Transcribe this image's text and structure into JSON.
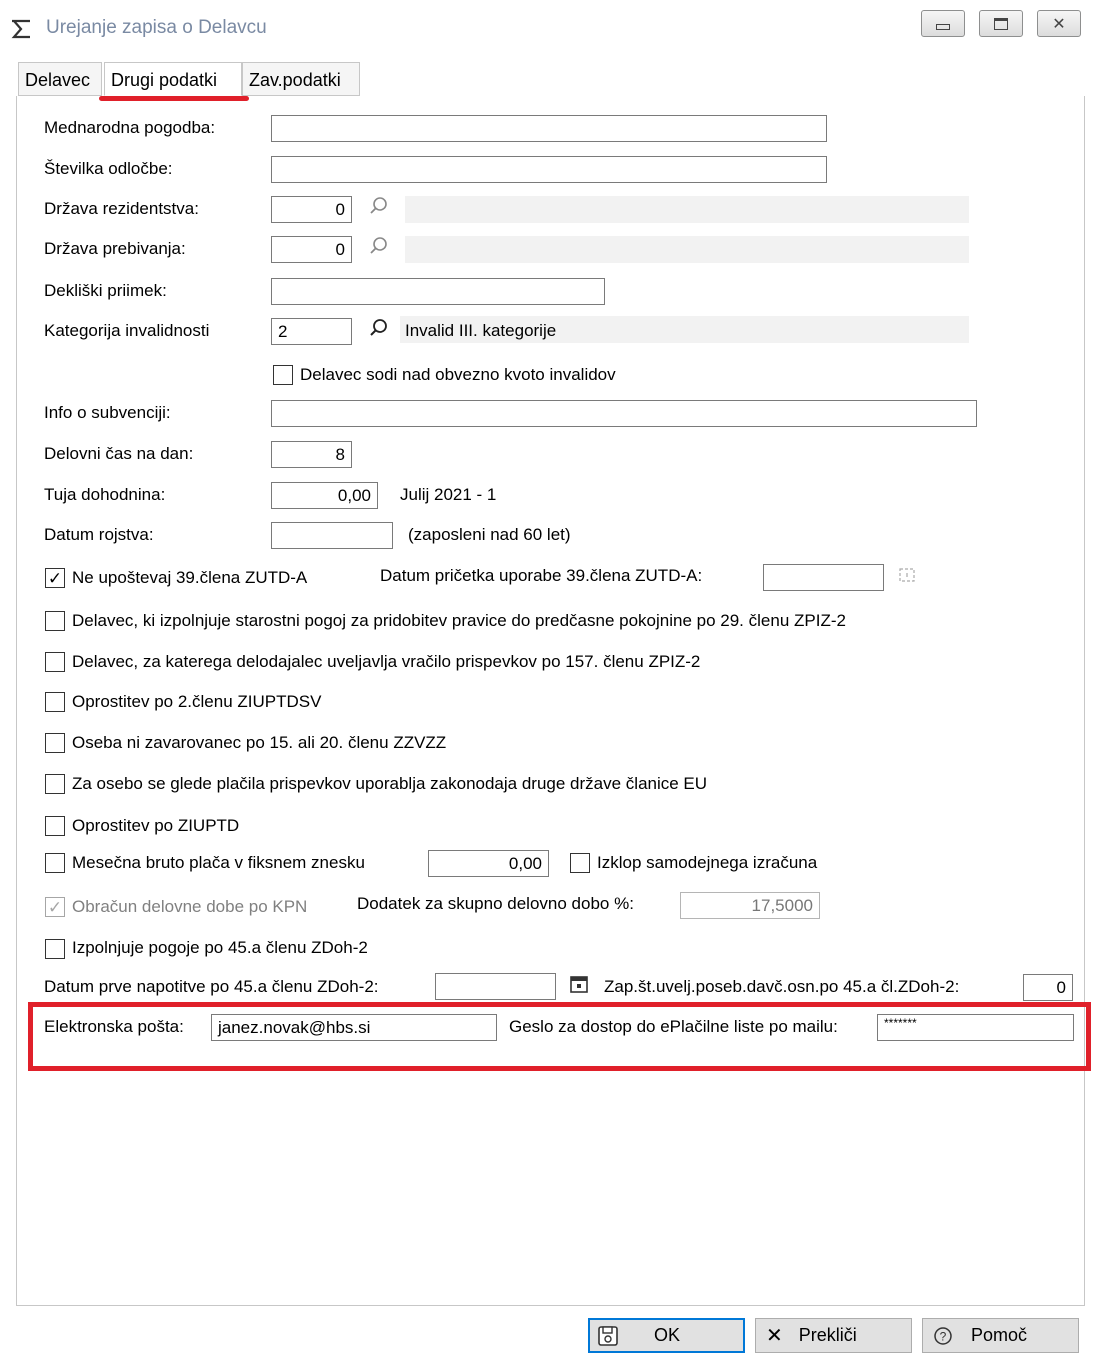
{
  "window": {
    "title": "Urejanje zapisa o Delavcu"
  },
  "tabs": [
    {
      "label": "Delavec"
    },
    {
      "label": "Drugi podatki"
    },
    {
      "label": "Zav.podatki"
    }
  ],
  "form": {
    "mednarodna_pogodba": {
      "label": "Mednarodna pogodba:",
      "value": ""
    },
    "stevilka_odlocbe": {
      "label": "Številka odločbe:",
      "value": ""
    },
    "drzava_rezidentstva": {
      "label": "Država rezidentstva:",
      "value": "0",
      "name": ""
    },
    "drzava_prebivanja": {
      "label": "Država prebivanja:",
      "value": "0",
      "name": ""
    },
    "dekliski_priimek": {
      "label": "Dekliški priimek:",
      "value": ""
    },
    "kategorija_invalidnosti": {
      "label": "Kategorija invalidnosti",
      "value": "2",
      "name": "Invalid III. kategorije"
    },
    "nad_kvoto": {
      "label": "Delavec sodi nad obvezno kvoto invalidov",
      "checked": false
    },
    "info_subvencija": {
      "label": "Info o subvenciji:",
      "value": ""
    },
    "delovni_cas": {
      "label": "Delovni čas na dan:",
      "value": "8"
    },
    "tuja_dohodnina": {
      "label": "Tuja dohodnina:",
      "value": "0,00",
      "period": "Julij 2021 - 1"
    },
    "datum_rojstva": {
      "label": "Datum rojstva:",
      "value": "",
      "note": "(zaposleni nad 60 let)"
    },
    "ne_upostevaj_39": {
      "label": "Ne upoštevaj 39.člena ZUTD-A",
      "checked": true
    },
    "datum_pricetka_39": {
      "label": "Datum pričetka uporabe 39.člena ZUTD-A:",
      "value": ""
    },
    "checks": [
      {
        "label": "Delavec, ki izpolnjuje starostni pogoj za pridobitev pravice do predčasne pokojnine po 29. členu ZPIZ-2",
        "checked": false
      },
      {
        "label": "Delavec, za katerega delodajalec uveljavlja vračilo prispevkov po 157. členu ZPIZ-2",
        "checked": false
      },
      {
        "label": "Oprostitev po 2.členu ZIUPTDSV",
        "checked": false
      },
      {
        "label": "Oseba ni zavarovanec po 15. ali 20. členu ZZVZZ",
        "checked": false
      },
      {
        "label": "Za osebo se glede plačila prispevkov uporablja zakonodaja druge države članice EU",
        "checked": false
      },
      {
        "label": "Oprostitev po ZIUPTD",
        "checked": false
      }
    ],
    "mesecna_bruto": {
      "label": "Mesečna bruto plača v fiksnem znesku",
      "value": "0,00",
      "checked": false
    },
    "izklop": {
      "label": "Izklop samodejnega izračuna",
      "checked": false
    },
    "obracun_kpn": {
      "label": "Obračun delovne dobe po KPN",
      "checked": true
    },
    "dodatek": {
      "label": "Dodatek za skupno delovno dobo %:",
      "value": "17,5000"
    },
    "izpolnjuje_45a": {
      "label": "Izpolnjuje pogoje po 45.a členu ZDoh-2",
      "checked": false
    },
    "datum_prve_napotitve": {
      "label": "Datum prve napotitve po 45.a členu ZDoh-2:",
      "value": ""
    },
    "zap_st": {
      "label": "Zap.št.uvelj.poseb.davč.osn.po 45.a čl.ZDoh-2:",
      "value": "0"
    },
    "email": {
      "label": "Elektronska pošta:",
      "value": "janez.novak@hbs.si"
    },
    "geslo": {
      "label": "Geslo za dostop do ePlačilne liste po mailu:",
      "value": "*******"
    }
  },
  "buttons": {
    "ok": "OK",
    "cancel": "Prekliči",
    "help": "Pomoč"
  },
  "colors": {
    "highlight": "#e0202a",
    "default_button_border": "#0078d7"
  }
}
